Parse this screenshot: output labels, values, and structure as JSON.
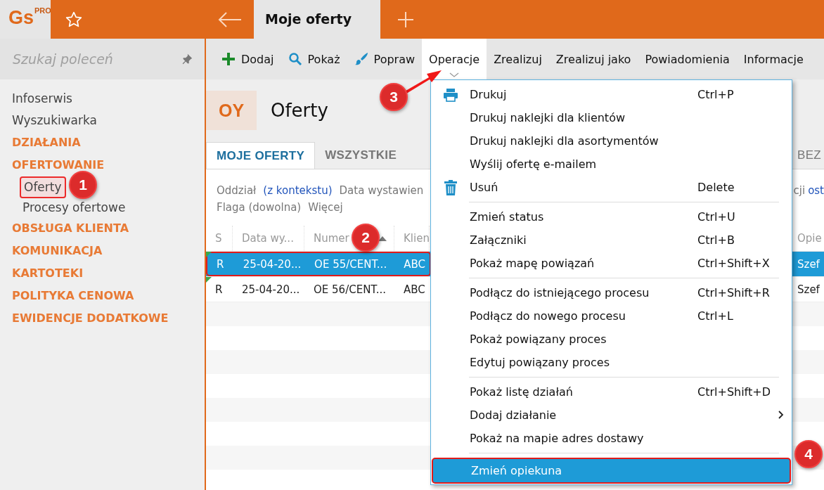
{
  "logo": {
    "text": "Gs",
    "badge": "PRO"
  },
  "tabs": [
    {
      "label": "Moje oferty",
      "selected": true
    }
  ],
  "search": {
    "placeholder": "Szukaj poleceń"
  },
  "sidebar": {
    "items": [
      {
        "label": "Infoserwis",
        "kind": "link",
        "highlighted": false
      },
      {
        "label": "Wyszukiwarka",
        "kind": "link",
        "highlighted": false
      },
      {
        "label": "DZIAŁANIA",
        "kind": "section",
        "highlighted": false
      },
      {
        "label": "OFERTOWANIE",
        "kind": "section",
        "highlighted": false,
        "children": [
          {
            "label": "Oferty",
            "kind": "link",
            "highlighted": true
          },
          {
            "label": "Procesy ofertowe",
            "kind": "link",
            "highlighted": false
          }
        ]
      },
      {
        "label": "OBSŁUGA KLIENTA",
        "kind": "section",
        "highlighted": false
      },
      {
        "label": "KOMUNIKACJA",
        "kind": "section",
        "highlighted": false
      },
      {
        "label": "KARTOTEKI",
        "kind": "section",
        "highlighted": false
      },
      {
        "label": "POLITYKA CENOWA",
        "kind": "section",
        "highlighted": false
      },
      {
        "label": "EWIDENCJE DODATKOWE",
        "kind": "section",
        "highlighted": false
      }
    ]
  },
  "toolbar": [
    {
      "label": "Dodaj",
      "kind": "add",
      "selected": false
    },
    {
      "label": "Pokaż",
      "kind": "view",
      "selected": false
    },
    {
      "label": "Popraw",
      "kind": "edit",
      "selected": false
    },
    {
      "label": "Operacje",
      "kind": "dropdown",
      "selected": true
    },
    {
      "label": "Zrealizuj",
      "kind": "plain",
      "selected": false
    },
    {
      "label": "Zrealizuj jako",
      "kind": "plain",
      "selected": false
    },
    {
      "label": "Powiadomienia",
      "kind": "plain",
      "selected": false
    },
    {
      "label": "Informacje",
      "kind": "plain",
      "selected": false
    }
  ],
  "header": {
    "code": "OY",
    "title": "Oferty"
  },
  "view_tabs": {
    "left": [
      {
        "label": "MOJE OFERTY",
        "selected": true
      },
      {
        "label": "WSZYSTKIE",
        "selected": false
      }
    ],
    "right": [
      {
        "label": "BEZ",
        "selected": false
      }
    ]
  },
  "filters": {
    "left_lines": [
      [
        {
          "text": "Oddział",
          "link": false
        },
        {
          "text": "(z kontekstu)",
          "link": true
        },
        {
          "text": "Data wystawien",
          "link": false
        }
      ],
      [
        {
          "text": "Flaga (dowolna)",
          "link": false
        },
        {
          "text": "Więcej",
          "link": false
        }
      ]
    ],
    "right": [
      {
        "text": "cji",
        "link": false
      },
      {
        "text": "ost",
        "link": true
      }
    ]
  },
  "table": {
    "columns": [
      {
        "label": "S"
      },
      {
        "label": "Data wy..."
      },
      {
        "label": "Numer",
        "sorted": true
      },
      {
        "label": "Klien"
      }
    ],
    "right_column": "Opie",
    "rows": [
      {
        "cells": [
          "R",
          "25-04-20...",
          "OE 55/CENT...",
          "ABC"
        ],
        "right": "Szef",
        "selected": true,
        "highlighted": true,
        "flagged": true
      },
      {
        "cells": [
          "R",
          "25-04-20...",
          "OE 56/CENT...",
          "ABC"
        ],
        "right": "Szef",
        "selected": false,
        "highlighted": false,
        "flagged": true
      }
    ]
  },
  "menu": {
    "groups": [
      [
        {
          "label": "Drukuj",
          "shortcut": "Ctrl+P",
          "kind": "print",
          "selected": false,
          "highlighted": false
        },
        {
          "label": "Drukuj naklejki dla klientów",
          "kind": "plain",
          "selected": false,
          "highlighted": false
        },
        {
          "label": "Drukuj naklejki dla asortymentów",
          "kind": "plain",
          "selected": false,
          "highlighted": false
        },
        {
          "label": "Wyślij ofertę e-mailem",
          "kind": "plain",
          "selected": false,
          "highlighted": false
        },
        {
          "label": "Usuń",
          "shortcut": "Delete",
          "kind": "delete",
          "selected": false,
          "highlighted": false
        }
      ],
      [
        {
          "label": "Zmień status",
          "shortcut": "Ctrl+U",
          "kind": "plain",
          "selected": false,
          "highlighted": false
        },
        {
          "label": "Załączniki",
          "shortcut": "Ctrl+B",
          "kind": "plain",
          "selected": false,
          "highlighted": false
        },
        {
          "label": "Pokaż mapę powiązań",
          "shortcut": "Ctrl+Shift+X",
          "kind": "plain",
          "selected": false,
          "highlighted": false
        }
      ],
      [
        {
          "label": "Podłącz do istniejącego procesu",
          "shortcut": "Ctrl+Shift+R",
          "kind": "plain",
          "selected": false,
          "highlighted": false
        },
        {
          "label": "Podłącz do nowego procesu",
          "shortcut": "Ctrl+L",
          "kind": "plain",
          "selected": false,
          "highlighted": false
        },
        {
          "label": "Pokaż powiązany proces",
          "kind": "plain",
          "selected": false,
          "highlighted": false
        },
        {
          "label": "Edytuj powiązany proces",
          "kind": "plain",
          "selected": false,
          "highlighted": false
        }
      ],
      [
        {
          "label": "Pokaż listę działań",
          "shortcut": "Ctrl+Shift+D",
          "kind": "plain",
          "selected": false,
          "highlighted": false
        },
        {
          "label": "Dodaj działanie",
          "kind": "submenu",
          "selected": false,
          "highlighted": false
        },
        {
          "label": "Pokaż na mapie adres dostawy",
          "kind": "plain",
          "selected": false,
          "highlighted": false
        }
      ],
      [
        {
          "label": "Zmień opiekuna",
          "kind": "plain",
          "selected": true,
          "highlighted": true
        }
      ]
    ]
  },
  "annotations": [
    {
      "label": "1"
    },
    {
      "label": "2"
    },
    {
      "label": "3"
    },
    {
      "label": "4"
    }
  ]
}
